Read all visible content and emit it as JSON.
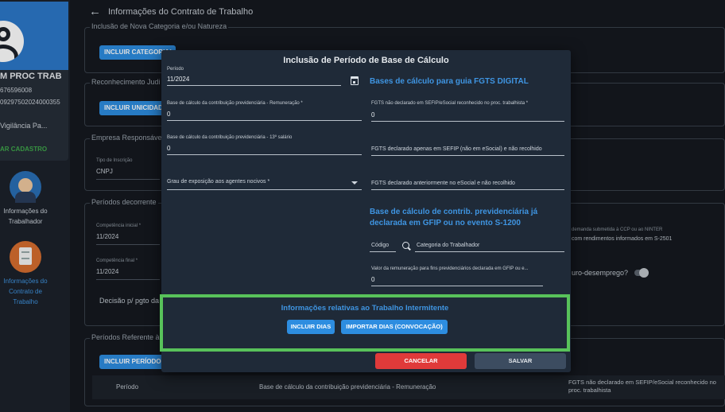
{
  "sidebar": {
    "profile_name": "M PROC TRAB",
    "profile_id1": "676596008",
    "profile_id2": "09297502024000355",
    "profile_company": "Vigilância Pa...",
    "profile_action": "AR CADASTRO",
    "nav": [
      {
        "label": "Informações do Trabalhador"
      },
      {
        "label": "Informações do Contrato de Trabalho"
      }
    ]
  },
  "page": {
    "title": "Informações do Contrato de Trabalho",
    "sections": {
      "nova_categoria": {
        "legend": "Inclusão de Nova Categoria e/ou Natureza",
        "button": "INCLUIR CATEGORIA/"
      },
      "reconhecimento": {
        "legend": "Reconhecimento Judi",
        "button": "INCLUIR UNICIDADE C"
      },
      "empresa": {
        "legend": "Empresa Responsáve",
        "tipo_label": "Tipo de Inscrição",
        "tipo_value": "CNPJ"
      },
      "periodos": {
        "legend": "Períodos decorrente",
        "competencia_inicial_label": "Competência inicial *",
        "competencia_inicial_value": "11/2024",
        "competencia_final_label": "Competência final *",
        "competencia_final_value": "11/2024",
        "decisao_text": "Decisão p/ pgto da",
        "right_note1": "demanda submetida à CCP ou ao NINTER",
        "right_note2": "com rendimentos informados em S-2501",
        "seguro_text": "uro-desemprego?"
      },
      "referente": {
        "legend": "Períodos Referente à",
        "button": "INCLUIR PERÍODO BAS",
        "table_headers": [
          "Período",
          "Base de cálculo da contribuição previdenciária - Remuneração",
          "FGTS não declarado em SEFIP/eSocial reconhecido no proc. trabalhista"
        ]
      }
    }
  },
  "modal": {
    "title": "Inclusão de Período de Base de Cálculo",
    "periodo_label": "Período",
    "periodo_value": "11/2024",
    "base_remuneracao_label": "Base de cálculo da contribuição previdenciária - Remuneração *",
    "base_remuneracao_value": "0",
    "base_13_label": "Base de cálculo da contribuição previdenciária - 13º salário",
    "base_13_value": "0",
    "grau_label": "Grau de exposição aos agentes nocivos *",
    "fgts_heading": "Bases de cálculo para guia FGTS DIGITAL",
    "fgts_nao_declarado_label": "FGTS não declarado em SEFIP/eSocial reconhecido no proc. trabalhista *",
    "fgts_nao_declarado_value": "0",
    "fgts_sefip_label": "FGTS declarado apenas em SEFIP (não em eSocial) e não recolhido",
    "fgts_esocial_label": "FGTS declarado anteriormente no eSocial e não recolhido",
    "gfip_heading": "Base de cálculo de contrib. previdenciária já declarada em GFIP ou no evento S-1200",
    "codigo_label": "Código",
    "categoria_label": "Categoria do Trabalhador",
    "valor_gfip_label": "Valor da remuneração para fins previdenciários declarada em GFIP ou e...",
    "valor_gfip_value": "0",
    "intermitente_title": "Informações relativas ao Trabalho Intermitente",
    "btn_incluir_dias": "INCLUIR DIAS",
    "btn_importar_dias": "IMPORTAR DIAS (CONVOCAÇÃO)",
    "btn_cancelar": "CANCELAR",
    "btn_salvar": "SALVAR"
  },
  "colors": {
    "accent": "#3f95e2",
    "button_blue": "#2d8de0",
    "cancel_red": "#e03a3a",
    "highlight_green": "#58c25a",
    "modal_bg": "#1f2a38"
  }
}
